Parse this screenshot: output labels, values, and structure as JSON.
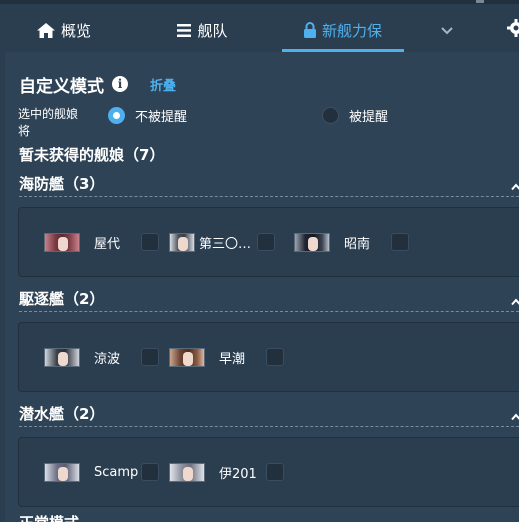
{
  "nav": {
    "items": [
      {
        "label": "概览",
        "icon": "home-icon"
      },
      {
        "label": "舰队",
        "icon": "list-icon"
      },
      {
        "label": "新舰力保",
        "icon": "lock-icon",
        "active": true
      }
    ],
    "dropdown_icon": "chevron-down-icon",
    "settings_icon": "gear-icon"
  },
  "header": {
    "title": "自定义模式",
    "info_icon": "info-icon",
    "fold_label": "折叠"
  },
  "selector": {
    "label": "选中的舰娘将",
    "options": [
      {
        "label": "不被提醒",
        "checked": true
      },
      {
        "label": "被提醒",
        "checked": false
      }
    ]
  },
  "unobtained": {
    "title": "暂未获得的舰娘（7）"
  },
  "categories": [
    {
      "title": "海防艦（3）",
      "ships": [
        {
          "name": "屋代",
          "checked": false
        },
        {
          "name": "第三〇号海防艦",
          "checked": false
        },
        {
          "name": "昭南",
          "checked": false
        }
      ]
    },
    {
      "title": "駆逐艦（2）",
      "ships": [
        {
          "name": "涼波",
          "checked": false
        },
        {
          "name": "早潮",
          "checked": false
        }
      ]
    },
    {
      "title": "潜水艦（2）",
      "ships": [
        {
          "name": "Scamp",
          "checked": false
        },
        {
          "name": "伊201",
          "checked": false
        }
      ]
    }
  ],
  "next_section": {
    "title": "正常模式"
  },
  "colors": {
    "accent": "#4fb0ee",
    "background": "#2b3e50",
    "panel": "#2f4356"
  }
}
